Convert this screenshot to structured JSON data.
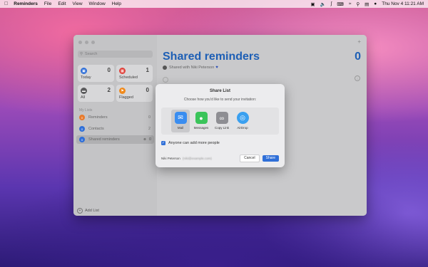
{
  "menubar": {
    "app": "Reminders",
    "items": [
      "File",
      "Edit",
      "View",
      "Window",
      "Help"
    ],
    "clock": "Thu Nov 4  11:21 AM"
  },
  "sidebar": {
    "search_placeholder": "Search",
    "tiles": [
      {
        "label": "Today",
        "count": "0",
        "color": "#2f6fd8"
      },
      {
        "label": "Scheduled",
        "count": "1",
        "color": "#e0413a"
      },
      {
        "label": "All",
        "count": "2",
        "color": "#5a5a5c"
      },
      {
        "label": "Flagged",
        "count": "0",
        "color": "#f08a1c"
      }
    ],
    "my_lists_heading": "My Lists",
    "lists": [
      {
        "label": "Reminders",
        "count": "0",
        "color": "#e87a2b"
      },
      {
        "label": "Contacts",
        "count": "2",
        "color": "#2f6fd8"
      },
      {
        "label": "Shared reminders",
        "count": "0",
        "color": "#2f6fd8"
      }
    ],
    "add_list": "Add List"
  },
  "main": {
    "title": "Shared reminders",
    "count": "0",
    "shared_with": "Shared with Niki Peterson"
  },
  "dialog": {
    "title": "Share List",
    "subtitle": "Choose how you'd like to send your invitation:",
    "options": [
      {
        "label": "Mail",
        "icon": "mail-icon",
        "color": "#3a8df0"
      },
      {
        "label": "Messages",
        "icon": "messages-icon",
        "color": "#3ac45a"
      },
      {
        "label": "Copy Link",
        "icon": "link-icon",
        "color": "#8e8e93"
      },
      {
        "label": "AirDrop",
        "icon": "airdrop-icon",
        "color": "#3aa0f0"
      }
    ],
    "checkbox_label": "Anyone can add more people",
    "sender": "Niki Peterson",
    "email": "(niki@example.com)",
    "cancel": "Cancel",
    "share": "Share"
  }
}
